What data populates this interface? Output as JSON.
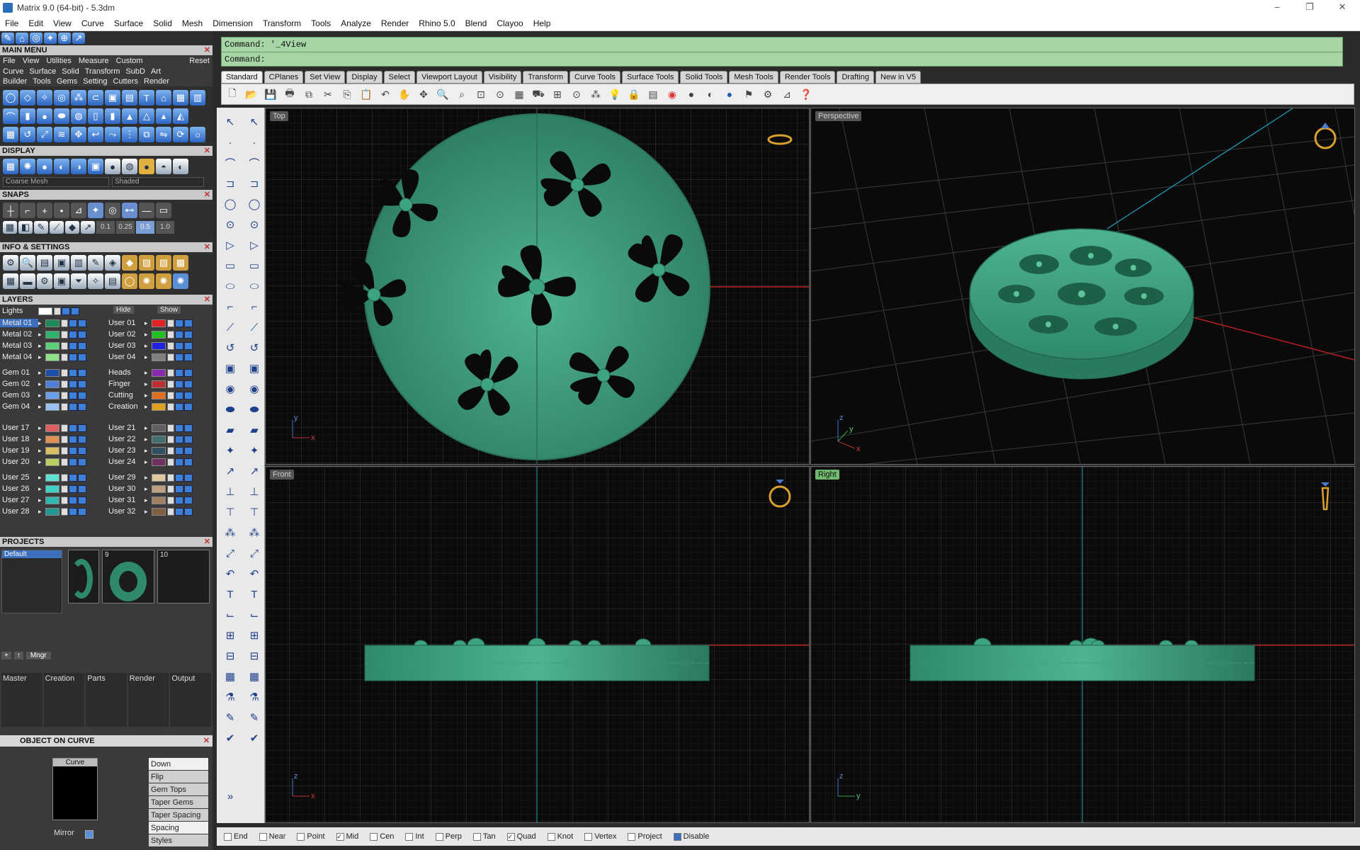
{
  "window": {
    "title": "Matrix 9.0 (64-bit) - 5.3dm",
    "minimize": "–",
    "maximize": "❐",
    "close": "✕"
  },
  "menubar": [
    "File",
    "Edit",
    "View",
    "Curve",
    "Surface",
    "Solid",
    "Mesh",
    "Dimension",
    "Transform",
    "Tools",
    "Analyze",
    "Render",
    "Rhino 5.0",
    "Blend",
    "Clayoo",
    "Help"
  ],
  "command": {
    "line1": "Command: '_4View",
    "line2": "Command:"
  },
  "tabs": [
    "Standard",
    "CPlanes",
    "Set View",
    "Display",
    "Select",
    "Viewport Layout",
    "Visibility",
    "Transform",
    "Curve Tools",
    "Surface Tools",
    "Solid Tools",
    "Mesh Tools",
    "Render Tools",
    "Drafting",
    "New in V5"
  ],
  "main_menu": {
    "title": "MAIN MENU",
    "row1": [
      "File",
      "View",
      "Utilities",
      "Measure",
      "Custom",
      "Reset"
    ],
    "row2": [
      "Curve",
      "Surface",
      "Solid",
      "Transform",
      "SubD",
      "Art"
    ],
    "row3": [
      "Builder",
      "Tools",
      "Gems",
      "Setting",
      "Cutters",
      "Render"
    ]
  },
  "display": {
    "title": "DISPLAY",
    "mesh": "Coarse Mesh",
    "mode": "Shaded"
  },
  "snaps": {
    "title": "SNAPS",
    "values": [
      "0.1",
      "0.25",
      "0.5",
      "1.0"
    ]
  },
  "info": {
    "title": "INFO & SETTINGS"
  },
  "layers": {
    "title": "LAYERS",
    "lights": "Lights",
    "hide": "Hide",
    "show": "Show",
    "left": [
      {
        "name": "Metal 01",
        "color": "#1e8a5a"
      },
      {
        "name": "Metal 02",
        "color": "#2fb36a"
      },
      {
        "name": "Metal 03",
        "color": "#5cd07a"
      },
      {
        "name": "Metal 04",
        "color": "#8ee08a"
      },
      {
        "name": "Gem 01",
        "color": "#1c4fa8"
      },
      {
        "name": "Gem 02",
        "color": "#4f7fd8"
      },
      {
        "name": "Gem 03",
        "color": "#6aa0ea"
      },
      {
        "name": "Gem 04",
        "color": "#9ac0f0"
      },
      {
        "name": "User 17",
        "color": "#e06060"
      },
      {
        "name": "User 18",
        "color": "#e09050"
      },
      {
        "name": "User 19",
        "color": "#d8c060"
      },
      {
        "name": "User 20",
        "color": "#b8d060"
      },
      {
        "name": "User 25",
        "color": "#60e0d0"
      },
      {
        "name": "User 26",
        "color": "#40d0c8"
      },
      {
        "name": "User 27",
        "color": "#30b8b0"
      },
      {
        "name": "User 28",
        "color": "#209890"
      }
    ],
    "right": [
      {
        "name": "User 01",
        "color": "#e02020"
      },
      {
        "name": "User 02",
        "color": "#20c020"
      },
      {
        "name": "User 03",
        "color": "#2020e0"
      },
      {
        "name": "User 04",
        "color": "#808080"
      },
      {
        "name": "Heads",
        "color": "#8a2ab0"
      },
      {
        "name": "Finger",
        "color": "#c03030"
      },
      {
        "name": "Cutting",
        "color": "#e07020"
      },
      {
        "name": "Creation",
        "color": "#e0a020"
      },
      {
        "name": "User 21",
        "color": "#606060"
      },
      {
        "name": "User 22",
        "color": "#407070"
      },
      {
        "name": "User 23",
        "color": "#305060"
      },
      {
        "name": "User 24",
        "color": "#703060"
      },
      {
        "name": "User 29",
        "color": "#e0c8a0"
      },
      {
        "name": "User 30",
        "color": "#c0a080"
      },
      {
        "name": "User 31",
        "color": "#a08060"
      },
      {
        "name": "User 32",
        "color": "#806040"
      }
    ]
  },
  "projects": {
    "title": "PROJECTS",
    "default": "Default",
    "thumb2": "9",
    "thumb3": "10",
    "mngr": "Mngr"
  },
  "project_tabs": [
    "Master",
    "Creation",
    "Parts",
    "Render",
    "Output"
  ],
  "object_on_curve": {
    "title": "OBJECT ON CURVE",
    "curve": "Curve",
    "mirror": "Mirror",
    "options": [
      {
        "label": "Down",
        "input": true
      },
      {
        "label": "Flip",
        "input": false
      },
      {
        "label": "Gem Tops",
        "input": false
      },
      {
        "label": "Taper Gems",
        "input": false
      },
      {
        "label": "Taper Spacing",
        "input": false
      },
      {
        "label": "Spacing",
        "input": true
      },
      {
        "label": "Styles",
        "input": false
      }
    ]
  },
  "viewports": {
    "top": "Top",
    "perspective": "Perspective",
    "front": "Front",
    "right": "Right"
  },
  "axes": {
    "x": "x",
    "y": "y",
    "z": "z"
  },
  "status": {
    "snaps": [
      {
        "label": "End",
        "checked": false
      },
      {
        "label": "Near",
        "checked": false
      },
      {
        "label": "Point",
        "checked": false
      },
      {
        "label": "Mid",
        "checked": true
      },
      {
        "label": "Cen",
        "checked": false
      },
      {
        "label": "Int",
        "checked": false
      },
      {
        "label": "Perp",
        "checked": false
      },
      {
        "label": "Tan",
        "checked": false
      },
      {
        "label": "Quad",
        "checked": true
      },
      {
        "label": "Knot",
        "checked": false
      },
      {
        "label": "Vertex",
        "checked": false
      },
      {
        "label": "Project",
        "checked": false
      },
      {
        "label": "Disable",
        "checked": false
      }
    ]
  },
  "colors": {
    "model": "#2e8a6a",
    "model_light": "#4fb38f",
    "grid": "#3a3a3a",
    "x_axis": "#b82020",
    "y_axis": "#20a0c0"
  }
}
